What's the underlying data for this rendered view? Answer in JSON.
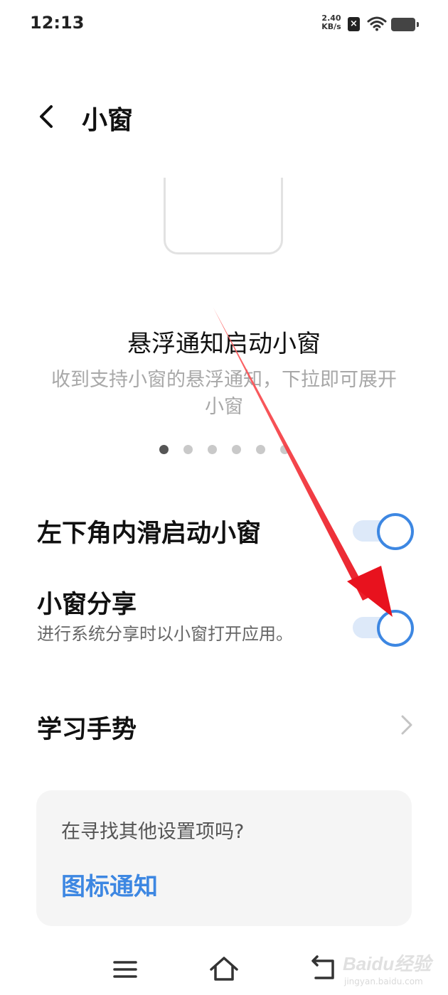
{
  "status_bar": {
    "time": "12:13",
    "net_speed_value": "2.40",
    "net_speed_unit": "KB/s",
    "notification_icon": "x-badge-icon",
    "wifi_icon": "wifi-icon",
    "battery_icon": "battery-icon"
  },
  "header": {
    "back_icon": "back-chevron-icon",
    "title": "小窗"
  },
  "feature_carousel": {
    "title": "悬浮通知启动小窗",
    "description": "收到支持小窗的悬浮通知，下拉即可展开小窗",
    "page_count": 6,
    "active_index": 0
  },
  "settings": {
    "swipe_row": {
      "label": "左下角内滑启动小窗",
      "enabled": true
    },
    "share_row": {
      "label": "小窗分享",
      "description": "进行系统分享时以小窗打开应用。",
      "enabled": true
    },
    "gesture_row": {
      "label": "学习手势",
      "chevron_icon": "chevron-right-icon"
    }
  },
  "suggestion_card": {
    "question": "在寻找其他设置项吗?",
    "link": "图标通知"
  },
  "nav_bar": {
    "menu_icon": "menu-icon",
    "home_icon": "home-icon",
    "back_icon": "return-icon"
  },
  "watermark": {
    "brand": "Baidu经验",
    "url": "jingyan.baidu.com"
  },
  "colors": {
    "accent": "#3d87e2",
    "toggle_track": "#dde9f9",
    "annotation_arrow": "#e8121e"
  }
}
